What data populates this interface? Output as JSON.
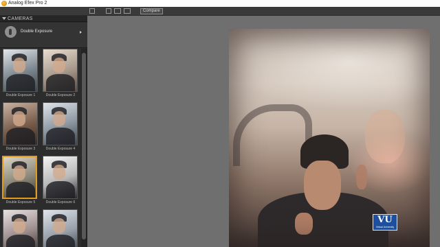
{
  "window": {
    "title": "Analog Efex Pro 2"
  },
  "toolbar": {
    "compare_label": "Compare"
  },
  "sidebar": {
    "header": "CAMERAS",
    "selected_preset": "Double Exposure",
    "thumbnails": [
      {
        "label": "Double Exposure 1"
      },
      {
        "label": "Double Exposure 2"
      },
      {
        "label": "Double Exposure 3"
      },
      {
        "label": "Double Exposure 4"
      },
      {
        "label": "Double Exposure 5",
        "selected": true
      },
      {
        "label": "Double Exposure 6"
      },
      {
        "label": ""
      },
      {
        "label": ""
      }
    ]
  },
  "watermark": {
    "mark": "VU",
    "subtitle": "Virtual University"
  },
  "colors": {
    "selection": "#e39a1f",
    "panel": "#2c2c2c",
    "canvas": "#6f6f6f",
    "logo": "#1d4f9e"
  }
}
